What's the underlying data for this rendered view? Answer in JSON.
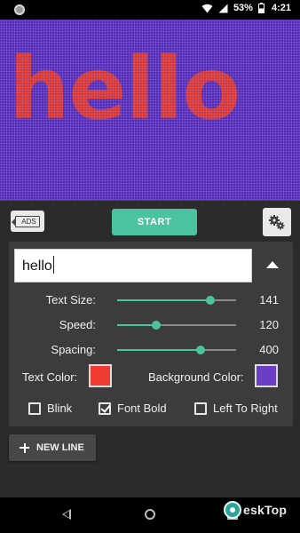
{
  "status_bar": {
    "battery_pct": "53%",
    "time": "4:21"
  },
  "preview": {
    "text": "hello",
    "text_color": "#ff4a2a",
    "background_color": "#4e2aa6"
  },
  "toolbar": {
    "ads_label": "ADS",
    "start_label": "START",
    "settings_icon": "gear-icon"
  },
  "editor": {
    "text_value": "hello",
    "sliders": [
      {
        "label": "Text Size:",
        "value": "141",
        "level": 0.78
      },
      {
        "label": "Speed:",
        "value": "120",
        "level": 0.33
      },
      {
        "label": "Spacing:",
        "value": "400",
        "level": 0.7
      }
    ],
    "text_color_label": "Text Color:",
    "text_color": "#f03c30",
    "background_color_label": "Background Color:",
    "background_color": "#6a3fc6",
    "checkboxes": [
      {
        "label": "Blink",
        "checked": false
      },
      {
        "label": "Font Bold",
        "checked": true
      },
      {
        "label": "Left To Right",
        "checked": false
      }
    ]
  },
  "new_line_label": "NEW LINE",
  "watermark": {
    "text": "eskTop"
  }
}
